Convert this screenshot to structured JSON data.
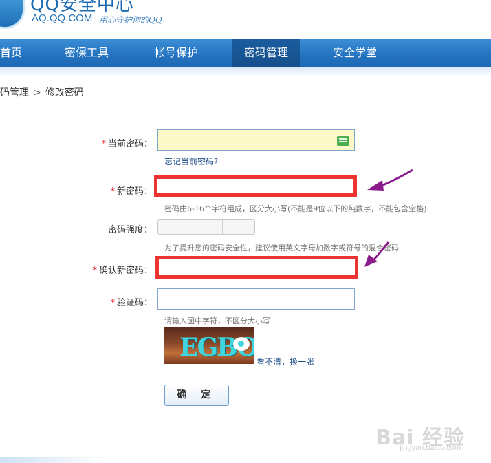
{
  "header": {
    "brand_title": "QQ安全中心",
    "brand_url": "AQ.QQ.COM",
    "brand_slogan": "用心守护你的QQ"
  },
  "nav": {
    "items": [
      {
        "label": "首页"
      },
      {
        "label": "密保工具"
      },
      {
        "label": "帐号保护"
      },
      {
        "label": "密码管理",
        "active": true
      },
      {
        "label": "安全学堂"
      }
    ]
  },
  "breadcrumb": {
    "parent": "密码管理",
    "separator": ">",
    "current": "修改密码"
  },
  "form": {
    "required_mark": "*",
    "current_password": {
      "label": "当前密码：",
      "value": "",
      "forgot_link": "忘记当前密码?"
    },
    "new_password": {
      "label": "新密码：",
      "value": "",
      "hint": "密码由6-16个字符组成，区分大小写(不能是9位以下的纯数字，不能包含空格)"
    },
    "strength": {
      "label": "密码强度：",
      "hint": "为了提升您的密码安全性，建议使用英文字母加数字或符号的混合密码"
    },
    "confirm_password": {
      "label": "确认新密码：",
      "value": ""
    },
    "captcha": {
      "label": "验证码：",
      "value": "",
      "hint": "请输入图中字符，不区分大小写",
      "image_text": "EGBO",
      "refresh_link": "看不清，换一张"
    },
    "submit_label": "确 定"
  },
  "annotation": {
    "color": "#8b1a8b",
    "box_color": "#ee3333"
  },
  "watermark": {
    "main": "Bai 经验",
    "sub": "jingyan.baidu.com"
  },
  "colors": {
    "nav": "#2474c2",
    "nav_active": "#154f8a",
    "required": "#e02020",
    "link": "#1f4e8a"
  }
}
